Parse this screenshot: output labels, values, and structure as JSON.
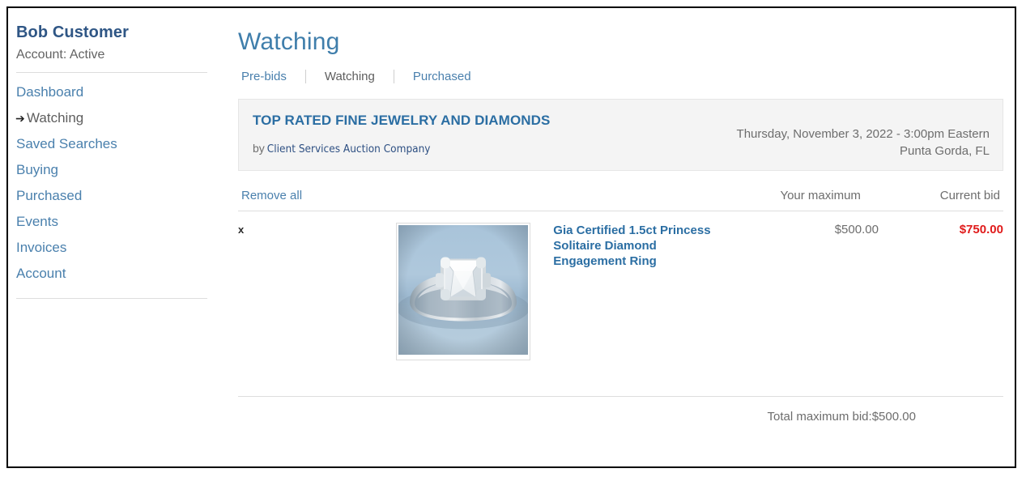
{
  "sidebar": {
    "user_name": "Bob Customer",
    "account_status": "Account: Active",
    "items": [
      {
        "label": "Dashboard",
        "current": false
      },
      {
        "label": "Watching",
        "current": true
      },
      {
        "label": "Saved Searches",
        "current": false
      },
      {
        "label": "Buying",
        "current": false
      },
      {
        "label": "Purchased",
        "current": false
      },
      {
        "label": "Events",
        "current": false
      },
      {
        "label": "Invoices",
        "current": false
      },
      {
        "label": "Account",
        "current": false
      }
    ],
    "current_marker": "➔"
  },
  "main": {
    "page_title": "Watching",
    "tabs": [
      {
        "label": "Pre-bids",
        "active": false
      },
      {
        "label": "Watching",
        "active": true
      },
      {
        "label": "Purchased",
        "active": false
      }
    ]
  },
  "auction": {
    "title": "TOP RATED FINE JEWELRY AND DIAMONDS",
    "by_label": "by",
    "company": "Client Services Auction Company",
    "datetime": "Thursday, November 3, 2022 - 3:00pm Eastern",
    "location": "Punta Gorda, FL"
  },
  "table": {
    "remove_all_label": "Remove all",
    "col_your_maximum": "Your maximum",
    "col_current_bid": "Current bid",
    "rows": [
      {
        "remove_label": "x",
        "thumb_alt": "diamond-engagement-ring-photo",
        "title": "Gia Certified 1.5ct Princess Solitaire Diamond Engagement Ring",
        "your_maximum": "$500.00",
        "current_bid": "$750.00"
      }
    ]
  },
  "footer": {
    "total_label": "Total maximum bid:",
    "total_value": "$500.00"
  },
  "colors": {
    "link_blue": "#4a80ad",
    "title_blue": "#3f7eab",
    "heading_blue": "#2b6ea3",
    "current_bid_red": "#e01b1b",
    "muted_grey": "#6d6d6d",
    "banner_bg": "#f4f4f4"
  }
}
